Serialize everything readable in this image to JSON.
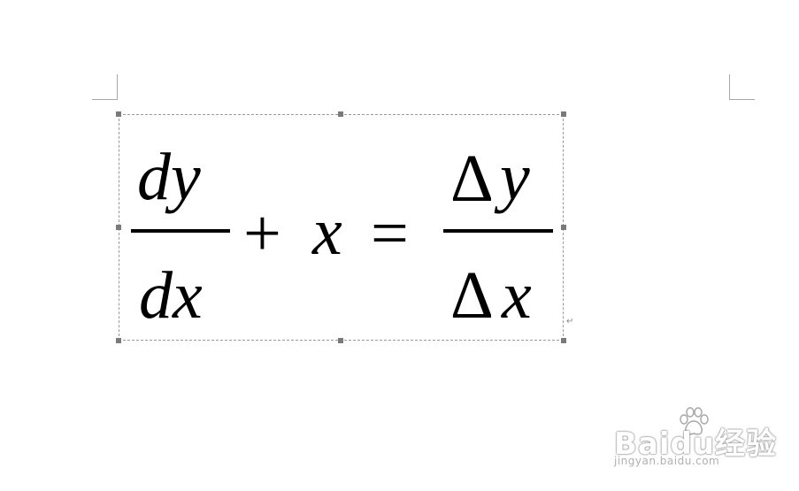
{
  "equation": {
    "lhs_numerator": "dy",
    "lhs_denominator": "dx",
    "plus": "+",
    "var": "x",
    "equals": "=",
    "rhs_numerator_delta": "Δ",
    "rhs_numerator_var": "y",
    "rhs_denominator_delta": "Δ",
    "rhs_denominator_var": "x"
  },
  "paragraph_mark": "↵",
  "watermark": {
    "logo": "Baidu经验",
    "site": "jingyan.baidu.com"
  }
}
